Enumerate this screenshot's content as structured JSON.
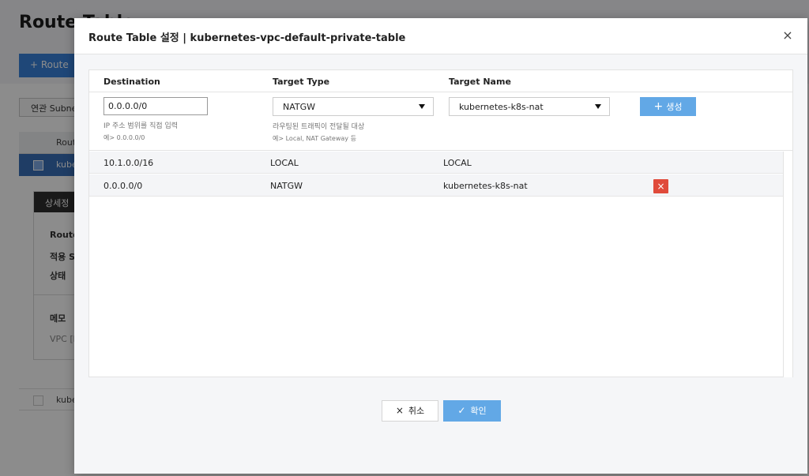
{
  "background": {
    "page_title": "Route Table",
    "add_button": "+ Route",
    "assoc_button": "연관 Subne",
    "table_header": "Rout",
    "selected_row": "kube",
    "detail_tab": "상세정",
    "labels": [
      "Route",
      "적용 S",
      "상태",
      "메모"
    ],
    "memo_value": "VPC [k",
    "row2": "kube"
  },
  "modal": {
    "title": "Route Table 설정 | kubernetes-vpc-default-private-table",
    "close_icon": "×",
    "columns": {
      "destination": "Destination",
      "target_type": "Target Type",
      "target_name": "Target Name"
    },
    "form": {
      "destination_value": "0.0.0.0/0",
      "destination_hint": "IP 주소 범위를 직접 입력",
      "destination_example": "예> 0.0.0.0/0",
      "target_type_value": "NATGW",
      "target_type_hint": "라우팅된 트래픽이 전달될 대상",
      "target_type_example": "예> Local, NAT Gateway 등",
      "target_name_value": "kubernetes-k8s-nat",
      "create_label": "생성",
      "create_icon": "+"
    },
    "routes": [
      {
        "destination": "10.1.0.0/16",
        "target_type": "LOCAL",
        "target_name": "LOCAL",
        "deletable": false
      },
      {
        "destination": "0.0.0.0/0",
        "target_type": "NATGW",
        "target_name": "kubernetes-k8s-nat",
        "deletable": true
      }
    ],
    "delete_icon": "×",
    "cancel_label": "취소",
    "cancel_icon": "×",
    "confirm_label": "확인",
    "confirm_icon": "✓"
  }
}
